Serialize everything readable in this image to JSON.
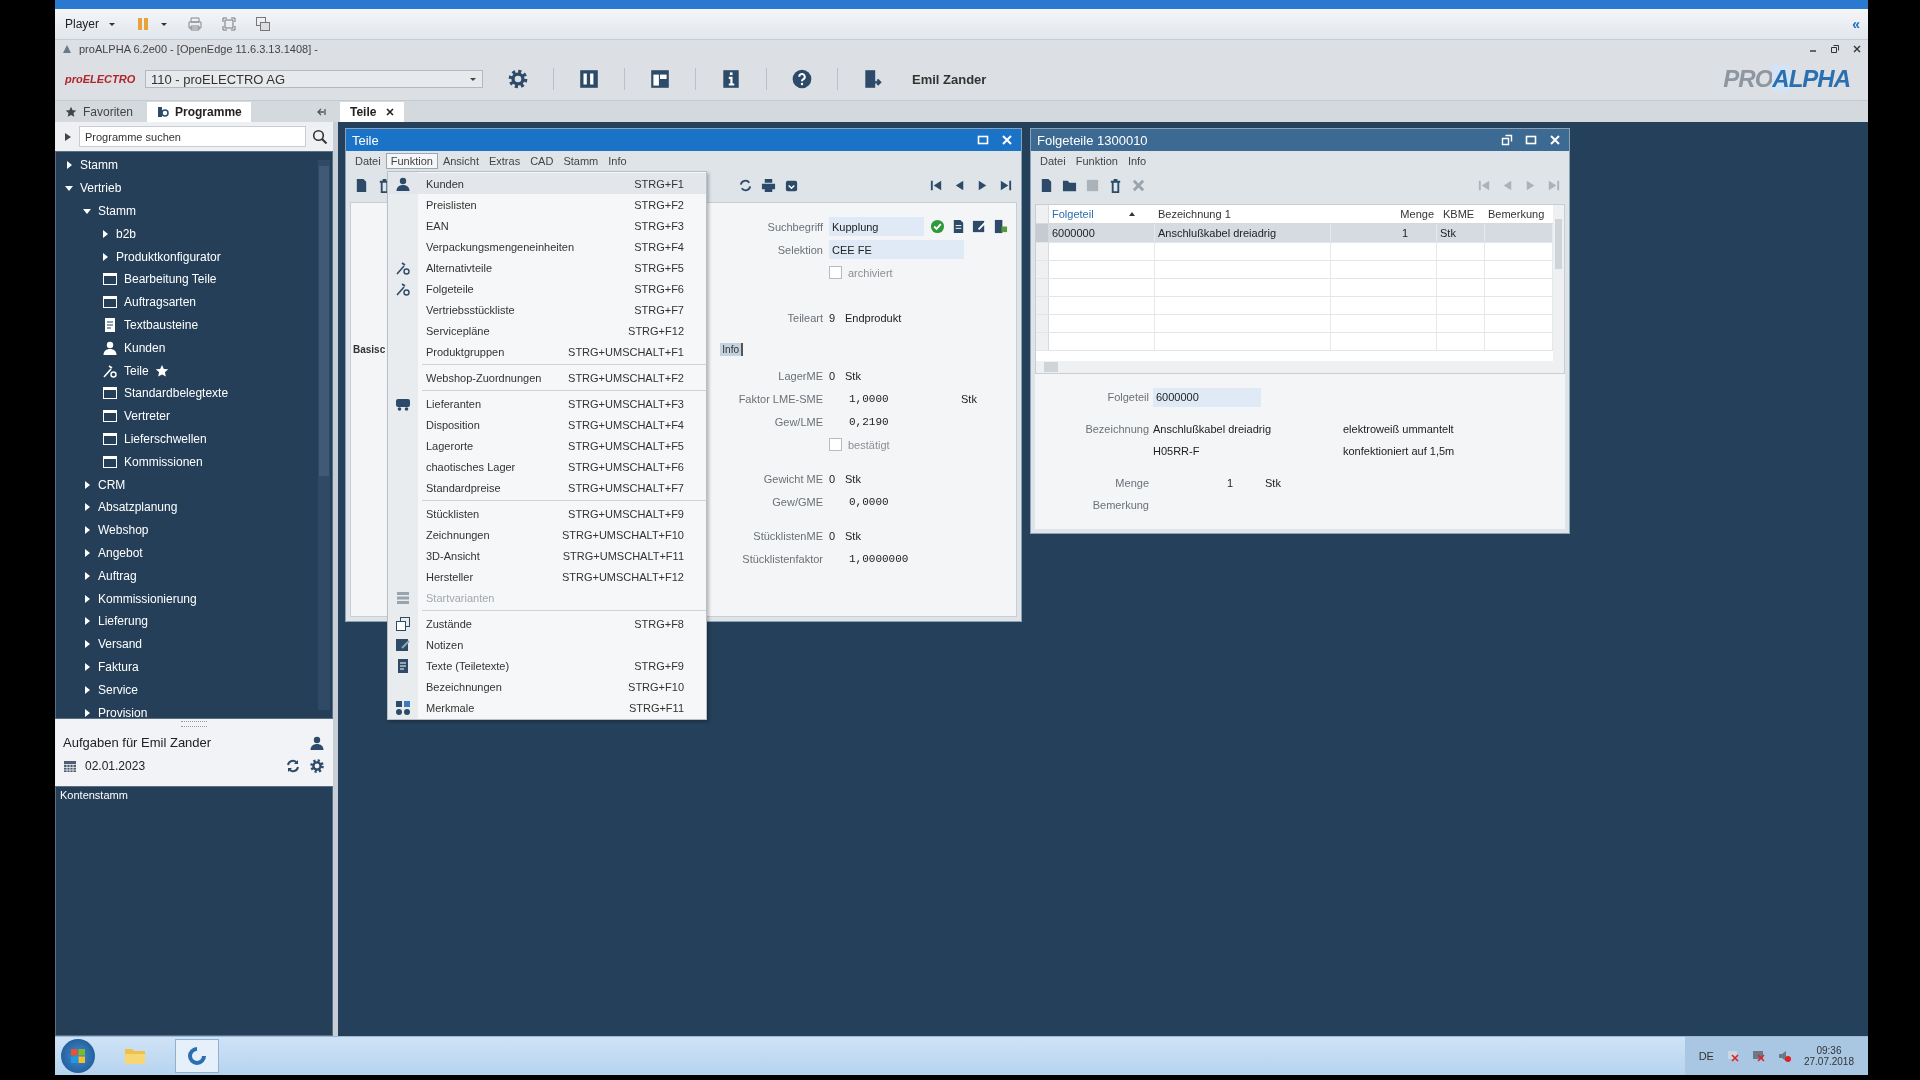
{
  "player_bar": {
    "label": "Player",
    "collapse": "«"
  },
  "app": {
    "title": "proALPHA 6.2e00 - [OpenEdge 11.6.3.13.1408] -",
    "logo": "proELECTRO",
    "company": "110 - proELECTRO AG",
    "user": "Emil Zander",
    "brand_left": "PRO",
    "brand_right": "ALPHA"
  },
  "sidebar": {
    "tabs": [
      {
        "label": "Favoriten",
        "selected": false
      },
      {
        "label": "Programme",
        "selected": true
      }
    ],
    "search": {
      "placeholder": "Programme suchen"
    },
    "tree": [
      {
        "label": "Stamm",
        "kind": "folder",
        "expanded": false
      },
      {
        "label": "Vertrieb",
        "kind": "folder",
        "expanded": true,
        "children": [
          {
            "label": "Stamm",
            "kind": "folder",
            "expanded": true,
            "children": [
              {
                "label": "b2b",
                "kind": "folder",
                "expanded": false
              },
              {
                "label": "Produktkonfigurator",
                "kind": "folder",
                "expanded": false
              },
              {
                "label": "Bearbeitung Teile",
                "kind": "window",
                "favorite": false
              },
              {
                "label": "Auftragsarten",
                "kind": "window",
                "favorite": false
              },
              {
                "label": "Textbausteine",
                "kind": "document",
                "favorite": false
              },
              {
                "label": "Kunden",
                "kind": "person",
                "favorite": false
              },
              {
                "label": "Teile",
                "kind": "part",
                "favorite": true
              },
              {
                "label": "Standardbelegtexte",
                "kind": "window",
                "favorite": false
              },
              {
                "label": "Vertreter",
                "kind": "window",
                "favorite": false
              },
              {
                "label": "Lieferschwellen",
                "kind": "window",
                "favorite": false
              },
              {
                "label": "Kommissionen",
                "kind": "window",
                "favorite": false
              }
            ]
          },
          {
            "label": "CRM",
            "kind": "folder",
            "expanded": false
          },
          {
            "label": "Absatzplanung",
            "kind": "folder",
            "expanded": false
          },
          {
            "label": "Webshop",
            "kind": "folder",
            "expanded": false
          },
          {
            "label": "Angebot",
            "kind": "folder",
            "expanded": false
          },
          {
            "label": "Auftrag",
            "kind": "folder",
            "expanded": false
          },
          {
            "label": "Kommissionierung",
            "kind": "folder",
            "expanded": false
          },
          {
            "label": "Lieferung",
            "kind": "folder",
            "expanded": false
          },
          {
            "label": "Versand",
            "kind": "folder",
            "expanded": false
          },
          {
            "label": "Faktura",
            "kind": "folder",
            "expanded": false
          },
          {
            "label": "Service",
            "kind": "folder",
            "expanded": false
          },
          {
            "label": "Provision",
            "kind": "folder",
            "expanded": false
          }
        ]
      }
    ],
    "tasks": {
      "title": "Aufgaben für Emil Zander",
      "date": "02.01.2023"
    },
    "bottom_list": [
      "Kontenstamm"
    ]
  },
  "doc_tabs": [
    {
      "label": "Teile",
      "selected": true
    }
  ],
  "teile_window": {
    "title": "Teile",
    "active": true,
    "menu": [
      {
        "label": "Datei",
        "selected": false
      },
      {
        "label": "Funktion",
        "selected": true
      },
      {
        "label": "Ansicht",
        "selected": false
      },
      {
        "label": "Extras",
        "selected": false
      },
      {
        "label": "CAD",
        "selected": false
      },
      {
        "label": "Stamm",
        "selected": false
      },
      {
        "label": "Info",
        "selected": false
      }
    ],
    "sections_top": [
      [
        {
          "label": "Suchbegriff",
          "kind": "input",
          "value": "Kupplung"
        },
        {
          "label": "Selektion",
          "kind": "input",
          "value": "CEE FE"
        },
        {
          "label": "archiviert",
          "kind": "check",
          "checked": false
        }
      ],
      [
        {
          "label": "Teileart",
          "kind": "code",
          "value": "9",
          "text": "Endprodukt"
        }
      ]
    ],
    "tabs": [
      {
        "label": "Basisc",
        "selected": true
      },
      {
        "label": "Info",
        "selected": false
      }
    ],
    "sections": [
      [
        {
          "label": "LagerME",
          "kind": "code",
          "value": "0",
          "text": "Stk"
        },
        {
          "label": "Faktor LME-SME",
          "kind": "number",
          "value": "1,0000",
          "unit": "Stk"
        },
        {
          "label": "Gew/LME",
          "kind": "number",
          "value": "0,2190"
        },
        {
          "label": "bestätigt",
          "kind": "check",
          "checked": false
        }
      ],
      [
        {
          "label": "Gewicht ME",
          "kind": "code",
          "value": "0",
          "text": "Stk"
        },
        {
          "label": "Gew/GME",
          "kind": "number",
          "value": "0,0000"
        }
      ],
      [
        {
          "label": "StücklistenME",
          "kind": "code",
          "value": "0",
          "text": "Stk"
        },
        {
          "label": "Stücklistenfaktor",
          "kind": "number",
          "value": "1,0000000"
        }
      ]
    ]
  },
  "function_menu": {
    "groups": [
      [
        {
          "label": "Kunden",
          "shortcut": "STRG+F1",
          "kind": "person",
          "selected": true,
          "disabled": false
        },
        {
          "label": "Preislisten",
          "shortcut": "STRG+F2",
          "kind": "plain",
          "selected": false,
          "disabled": false
        },
        {
          "label": "EAN",
          "shortcut": "STRG+F3",
          "kind": "plain",
          "selected": false,
          "disabled": false
        },
        {
          "label": "Verpackungsmengeneinheiten",
          "shortcut": "STRG+F4",
          "kind": "plain",
          "selected": false,
          "disabled": false
        },
        {
          "label": "Alternativteile",
          "shortcut": "STRG+F5",
          "kind": "part",
          "selected": false,
          "disabled": false
        },
        {
          "label": "Folgeteile",
          "shortcut": "STRG+F6",
          "kind": "part",
          "selected": false,
          "disabled": false
        },
        {
          "label": "Vertriebsstückliste",
          "shortcut": "STRG+F7",
          "kind": "plain",
          "selected": false,
          "disabled": false
        },
        {
          "label": "Servicepläne",
          "shortcut": "STRG+F12",
          "kind": "plain",
          "selected": false,
          "disabled": false
        },
        {
          "label": "Produktgruppen",
          "shortcut": "STRG+UMSCHALT+F1",
          "kind": "plain",
          "selected": false,
          "disabled": false
        }
      ],
      [
        {
          "label": "Webshop-Zuordnungen",
          "shortcut": "STRG+UMSCHALT+F2",
          "kind": "plain",
          "selected": false,
          "disabled": false
        }
      ],
      [
        {
          "label": "Lieferanten",
          "shortcut": "STRG+UMSCHALT+F3",
          "kind": "vehicle",
          "selected": false,
          "disabled": false
        },
        {
          "label": "Disposition",
          "shortcut": "STRG+UMSCHALT+F4",
          "kind": "plain",
          "selected": false,
          "disabled": false
        },
        {
          "label": "Lagerorte",
          "shortcut": "STRG+UMSCHALT+F5",
          "kind": "plain",
          "selected": false,
          "disabled": false
        },
        {
          "label": "chaotisches Lager",
          "shortcut": "STRG+UMSCHALT+F6",
          "kind": "plain",
          "selected": false,
          "disabled": false
        },
        {
          "label": "Standardpreise",
          "shortcut": "STRG+UMSCHALT+F7",
          "kind": "plain",
          "selected": false,
          "disabled": false
        }
      ],
      [
        {
          "label": "Stücklisten",
          "shortcut": "STRG+UMSCHALT+F9",
          "kind": "plain",
          "selected": false,
          "disabled": false
        },
        {
          "label": "Zeichnungen",
          "shortcut": "STRG+UMSCHALT+F10",
          "kind": "plain",
          "selected": false,
          "disabled": false
        },
        {
          "label": "3D-Ansicht",
          "shortcut": "STRG+UMSCHALT+F11",
          "kind": "plain",
          "selected": false,
          "disabled": false
        },
        {
          "label": "Hersteller",
          "shortcut": "STRG+UMSCHALT+F12",
          "kind": "plain",
          "selected": false,
          "disabled": false
        },
        {
          "label": "Startvarianten",
          "kind": "stack",
          "selected": false,
          "disabled": true
        }
      ],
      [
        {
          "label": "Zustände",
          "shortcut": "STRG+F8",
          "kind": "copies",
          "selected": false,
          "disabled": false
        },
        {
          "label": "Notizen",
          "kind": "note",
          "selected": false,
          "disabled": false
        },
        {
          "label": "Texte (Teiletexte)",
          "shortcut": "STRG+F9",
          "kind": "document",
          "selected": false,
          "disabled": false
        },
        {
          "label": "Bezeichnungen",
          "shortcut": "STRG+F10",
          "kind": "plain",
          "selected": false,
          "disabled": false
        },
        {
          "label": "Merkmale",
          "shortcut": "STRG+F11",
          "kind": "shapes",
          "selected": false,
          "disabled": false
        }
      ]
    ]
  },
  "folgeteile_window": {
    "title": "Folgeteile 1300010",
    "active": false,
    "menu": [
      {
        "label": "Datei",
        "selected": false
      },
      {
        "label": "Funktion",
        "selected": false
      },
      {
        "label": "Info",
        "selected": false
      }
    ],
    "table": {
      "columns": [
        {
          "label": "Folgeteil",
          "sorted": true
        },
        {
          "label": "Bezeichnung 1",
          "sorted": false
        },
        {
          "label": "Menge",
          "sorted": false
        },
        {
          "label": "KBME",
          "sorted": false
        },
        {
          "label": "Bemerkung",
          "sorted": false
        }
      ],
      "rows": [
        {
          "cells": [
            "6000000",
            "Anschlußkabel dreiadrig",
            "1",
            "Stk",
            ""
          ],
          "selected": true
        }
      ]
    },
    "sections": [
      [
        {
          "label": "Folgeteil",
          "kind": "input",
          "value": "6000000"
        }
      ],
      [
        {
          "label": "Bezeichnung",
          "kind": "text",
          "value": "Anschlußkabel dreiadrig",
          "extra": "elektroweiß ummantelt"
        },
        {
          "kind": "text",
          "value": "H05RR-F",
          "extra": "konfektioniert auf 1,5m"
        }
      ],
      [
        {
          "label": "Menge",
          "kind": "qty",
          "value": "1",
          "unit": "Stk"
        },
        {
          "label": "Bemerkung",
          "kind": "text"
        }
      ]
    ]
  },
  "taskbar": {
    "language": "DE",
    "time": "09:36",
    "date": "27.07.2018"
  }
}
